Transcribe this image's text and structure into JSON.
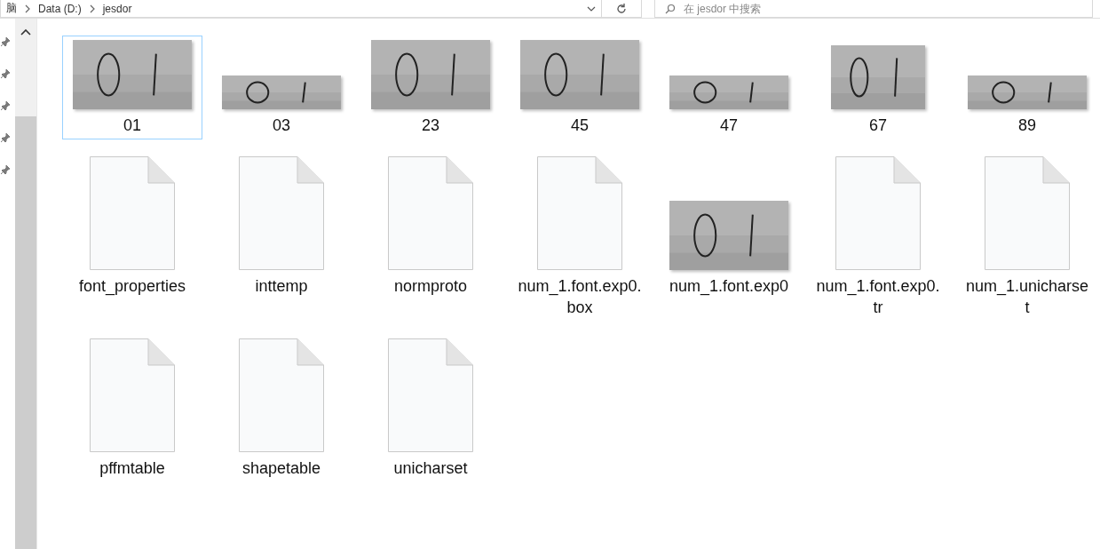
{
  "address_bar": {
    "path": [
      "脑",
      "Data (D:)",
      "jesdor"
    ]
  },
  "search": {
    "placeholder": "在 jesdor 中搜索"
  },
  "items": [
    {
      "name": "01",
      "selected": true
    },
    {
      "name": "03",
      "selected": false
    },
    {
      "name": "23",
      "selected": false
    },
    {
      "name": "45",
      "selected": false
    },
    {
      "name": "47",
      "selected": false
    },
    {
      "name": "67",
      "selected": false
    },
    {
      "name": "89",
      "selected": false
    },
    {
      "name": "font_properties",
      "kind": "file",
      "selected": false
    },
    {
      "name": "inttemp",
      "kind": "file",
      "selected": false
    },
    {
      "name": "normproto",
      "kind": "file",
      "selected": false
    },
    {
      "name": "num_1.font.exp0.box",
      "kind": "file",
      "selected": false
    },
    {
      "name": "num_1.font.exp0",
      "selected": false
    },
    {
      "name": "num_1.font.exp0.tr",
      "kind": "file",
      "selected": false
    },
    {
      "name": "num_1.unicharset",
      "kind": "file",
      "selected": false
    },
    {
      "name": "pffmtable",
      "kind": "file",
      "selected": false
    },
    {
      "name": "shapetable",
      "kind": "file",
      "selected": false
    },
    {
      "name": "unicharset",
      "kind": "file",
      "selected": false
    }
  ]
}
